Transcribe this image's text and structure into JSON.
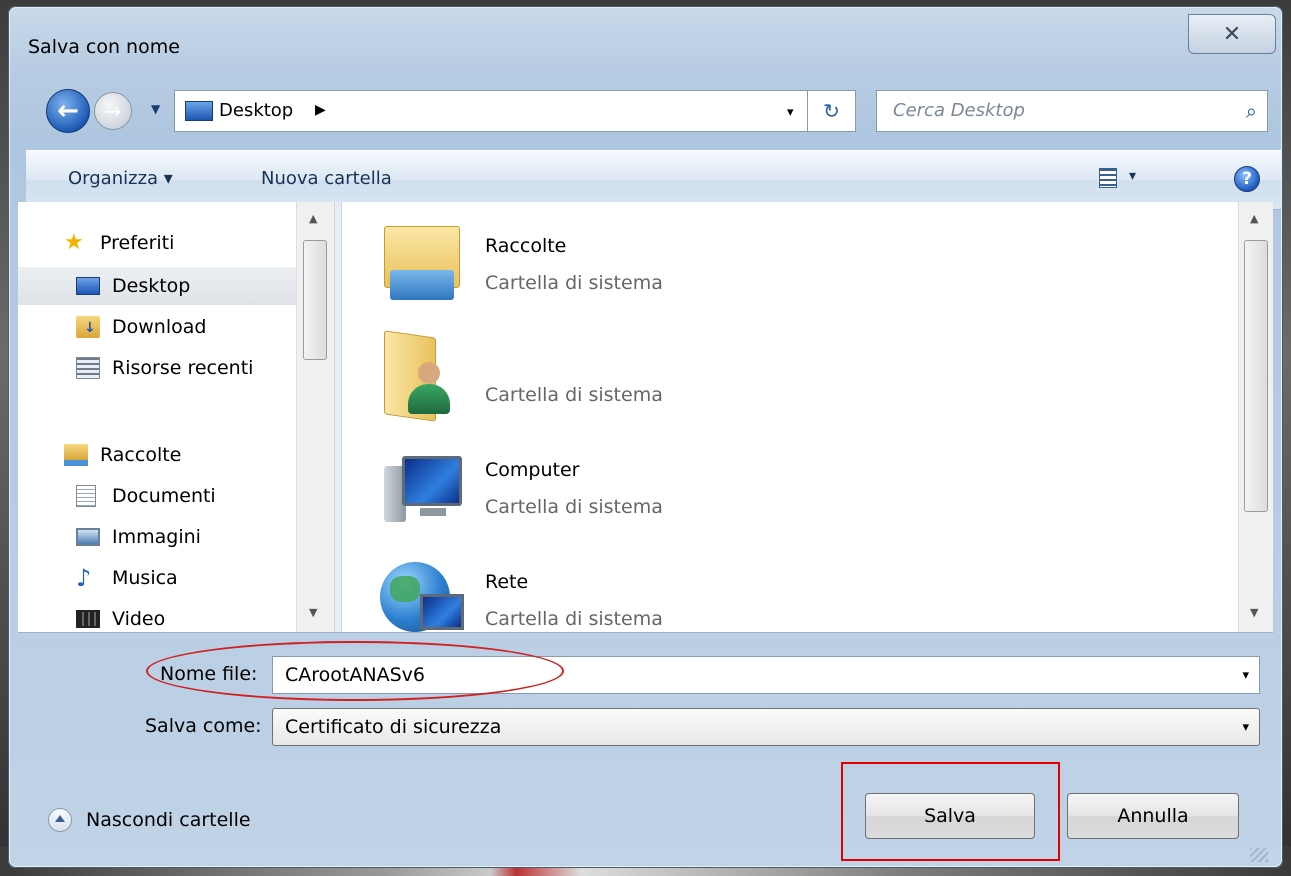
{
  "window": {
    "title": "Salva con nome",
    "close_glyph": "✕"
  },
  "navigation": {
    "back_glyph": "←",
    "address": {
      "location": "Desktop",
      "chevron": "▶",
      "dropdown": "▾"
    },
    "refresh_glyph": "↻",
    "search": {
      "placeholder": "Cerca Desktop",
      "icon": "search-icon"
    }
  },
  "toolbar": {
    "organize": "Organizza ▾",
    "new_folder": "Nuova cartella",
    "help": "?",
    "view_arrow": "▾"
  },
  "nav_pane": {
    "items": [
      {
        "label": "Preferiti",
        "icon": "star-icon",
        "kind": "header"
      },
      {
        "label": "Desktop",
        "icon": "desktop-icon",
        "selected": true
      },
      {
        "label": "Download",
        "icon": "download-folder-icon"
      },
      {
        "label": "Risorse recenti",
        "icon": "recent-places-icon"
      },
      {
        "label": "Raccolte",
        "icon": "libraries-icon",
        "kind": "header"
      },
      {
        "label": "Documenti",
        "icon": "documents-icon"
      },
      {
        "label": "Immagini",
        "icon": "pictures-icon"
      },
      {
        "label": "Musica",
        "icon": "music-icon"
      },
      {
        "label": "Video",
        "icon": "video-icon"
      }
    ]
  },
  "files": [
    {
      "name": "Raccolte",
      "type": "Cartella di sistema",
      "icon": "libraries-folder-icon"
    },
    {
      "name": "",
      "type": "Cartella di sistema",
      "icon": "user-folder-icon"
    },
    {
      "name": "Computer",
      "type": "Cartella di sistema",
      "icon": "computer-icon"
    },
    {
      "name": "Rete",
      "type": "Cartella di sistema",
      "icon": "network-icon"
    }
  ],
  "form": {
    "filename_label": "Nome file:",
    "filename_value": "CArootANASv6",
    "savetype_label": "Salva come:",
    "savetype_value": "Certificato di sicurezza",
    "dropdown": "▾"
  },
  "footer": {
    "hide_folders": "Nascondi cartelle",
    "save": "Salva",
    "cancel": "Annulla"
  },
  "colors": {
    "annotation_red": "#e00000",
    "title_bar": "#b8cde3",
    "selection": "#dfe3e8"
  }
}
